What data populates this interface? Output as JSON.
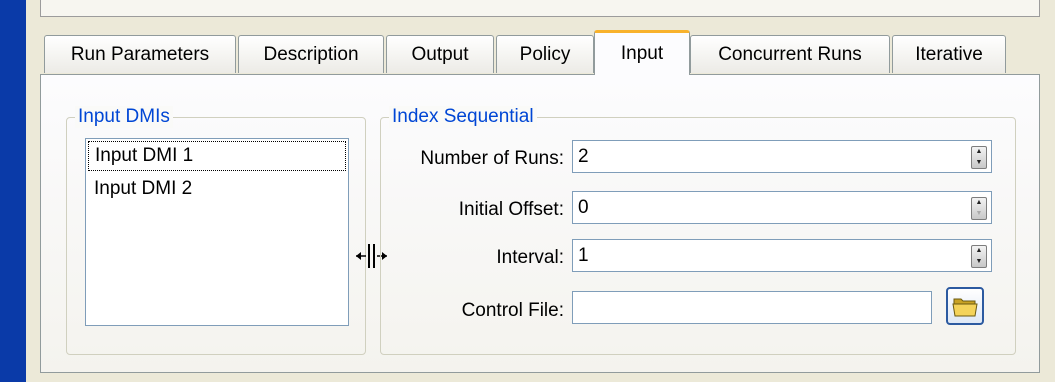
{
  "tabs": [
    {
      "label": "Run Parameters"
    },
    {
      "label": "Description"
    },
    {
      "label": "Output"
    },
    {
      "label": "Policy"
    },
    {
      "label": "Input"
    },
    {
      "label": "Concurrent Runs"
    },
    {
      "label": "Iterative"
    }
  ],
  "active_tab": "Input",
  "input_dmis": {
    "title": "Input DMIs",
    "items": [
      "Input DMI 1",
      "Input DMI 2"
    ]
  },
  "index_sequential": {
    "title": "Index Sequential",
    "number_of_runs_label": "Number of Runs:",
    "number_of_runs_value": "2",
    "initial_offset_label": "Initial Offset:",
    "initial_offset_value": "0",
    "interval_label": "Interval:",
    "interval_value": "1",
    "control_file_label": "Control File:",
    "control_file_value": ""
  },
  "icons": {
    "browse": "folder-icon",
    "cursor": "resize-horizontal-icon"
  },
  "colors": {
    "group_title": "#0046d5",
    "active_tab_accent": "#f8b22c",
    "window_border": "#0a3aa8"
  }
}
